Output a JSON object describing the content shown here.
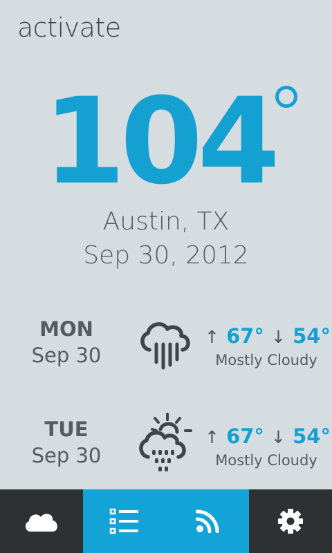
{
  "app": {
    "title": "activate"
  },
  "current": {
    "temperature": "104",
    "location": "Austin, TX",
    "date": "Sep 30, 2012"
  },
  "forecast": [
    {
      "day": "MON",
      "date": "Sep 30",
      "high": "67°",
      "low": "54°",
      "condition": "Mostly Cloudy",
      "icon": "rain-cloud-icon"
    },
    {
      "day": "TUE",
      "date": "Sep 30",
      "high": "67°",
      "low": "54°",
      "condition": "Mostly Cloudy",
      "icon": "sun-cloud-rain-icon"
    }
  ],
  "nav": {
    "items": [
      {
        "name": "weather",
        "icon": "cloud-icon",
        "active": false
      },
      {
        "name": "list",
        "icon": "list-icon",
        "active": true
      },
      {
        "name": "feed",
        "icon": "rss-icon",
        "active": true
      },
      {
        "name": "settings",
        "icon": "gear-icon",
        "active": false
      }
    ]
  },
  "colors": {
    "background": "#d5dde0",
    "accent": "#15a0d2",
    "text": "#555c60",
    "nav_dark": "#2e3133",
    "nav_blue": "#13a3d6"
  }
}
